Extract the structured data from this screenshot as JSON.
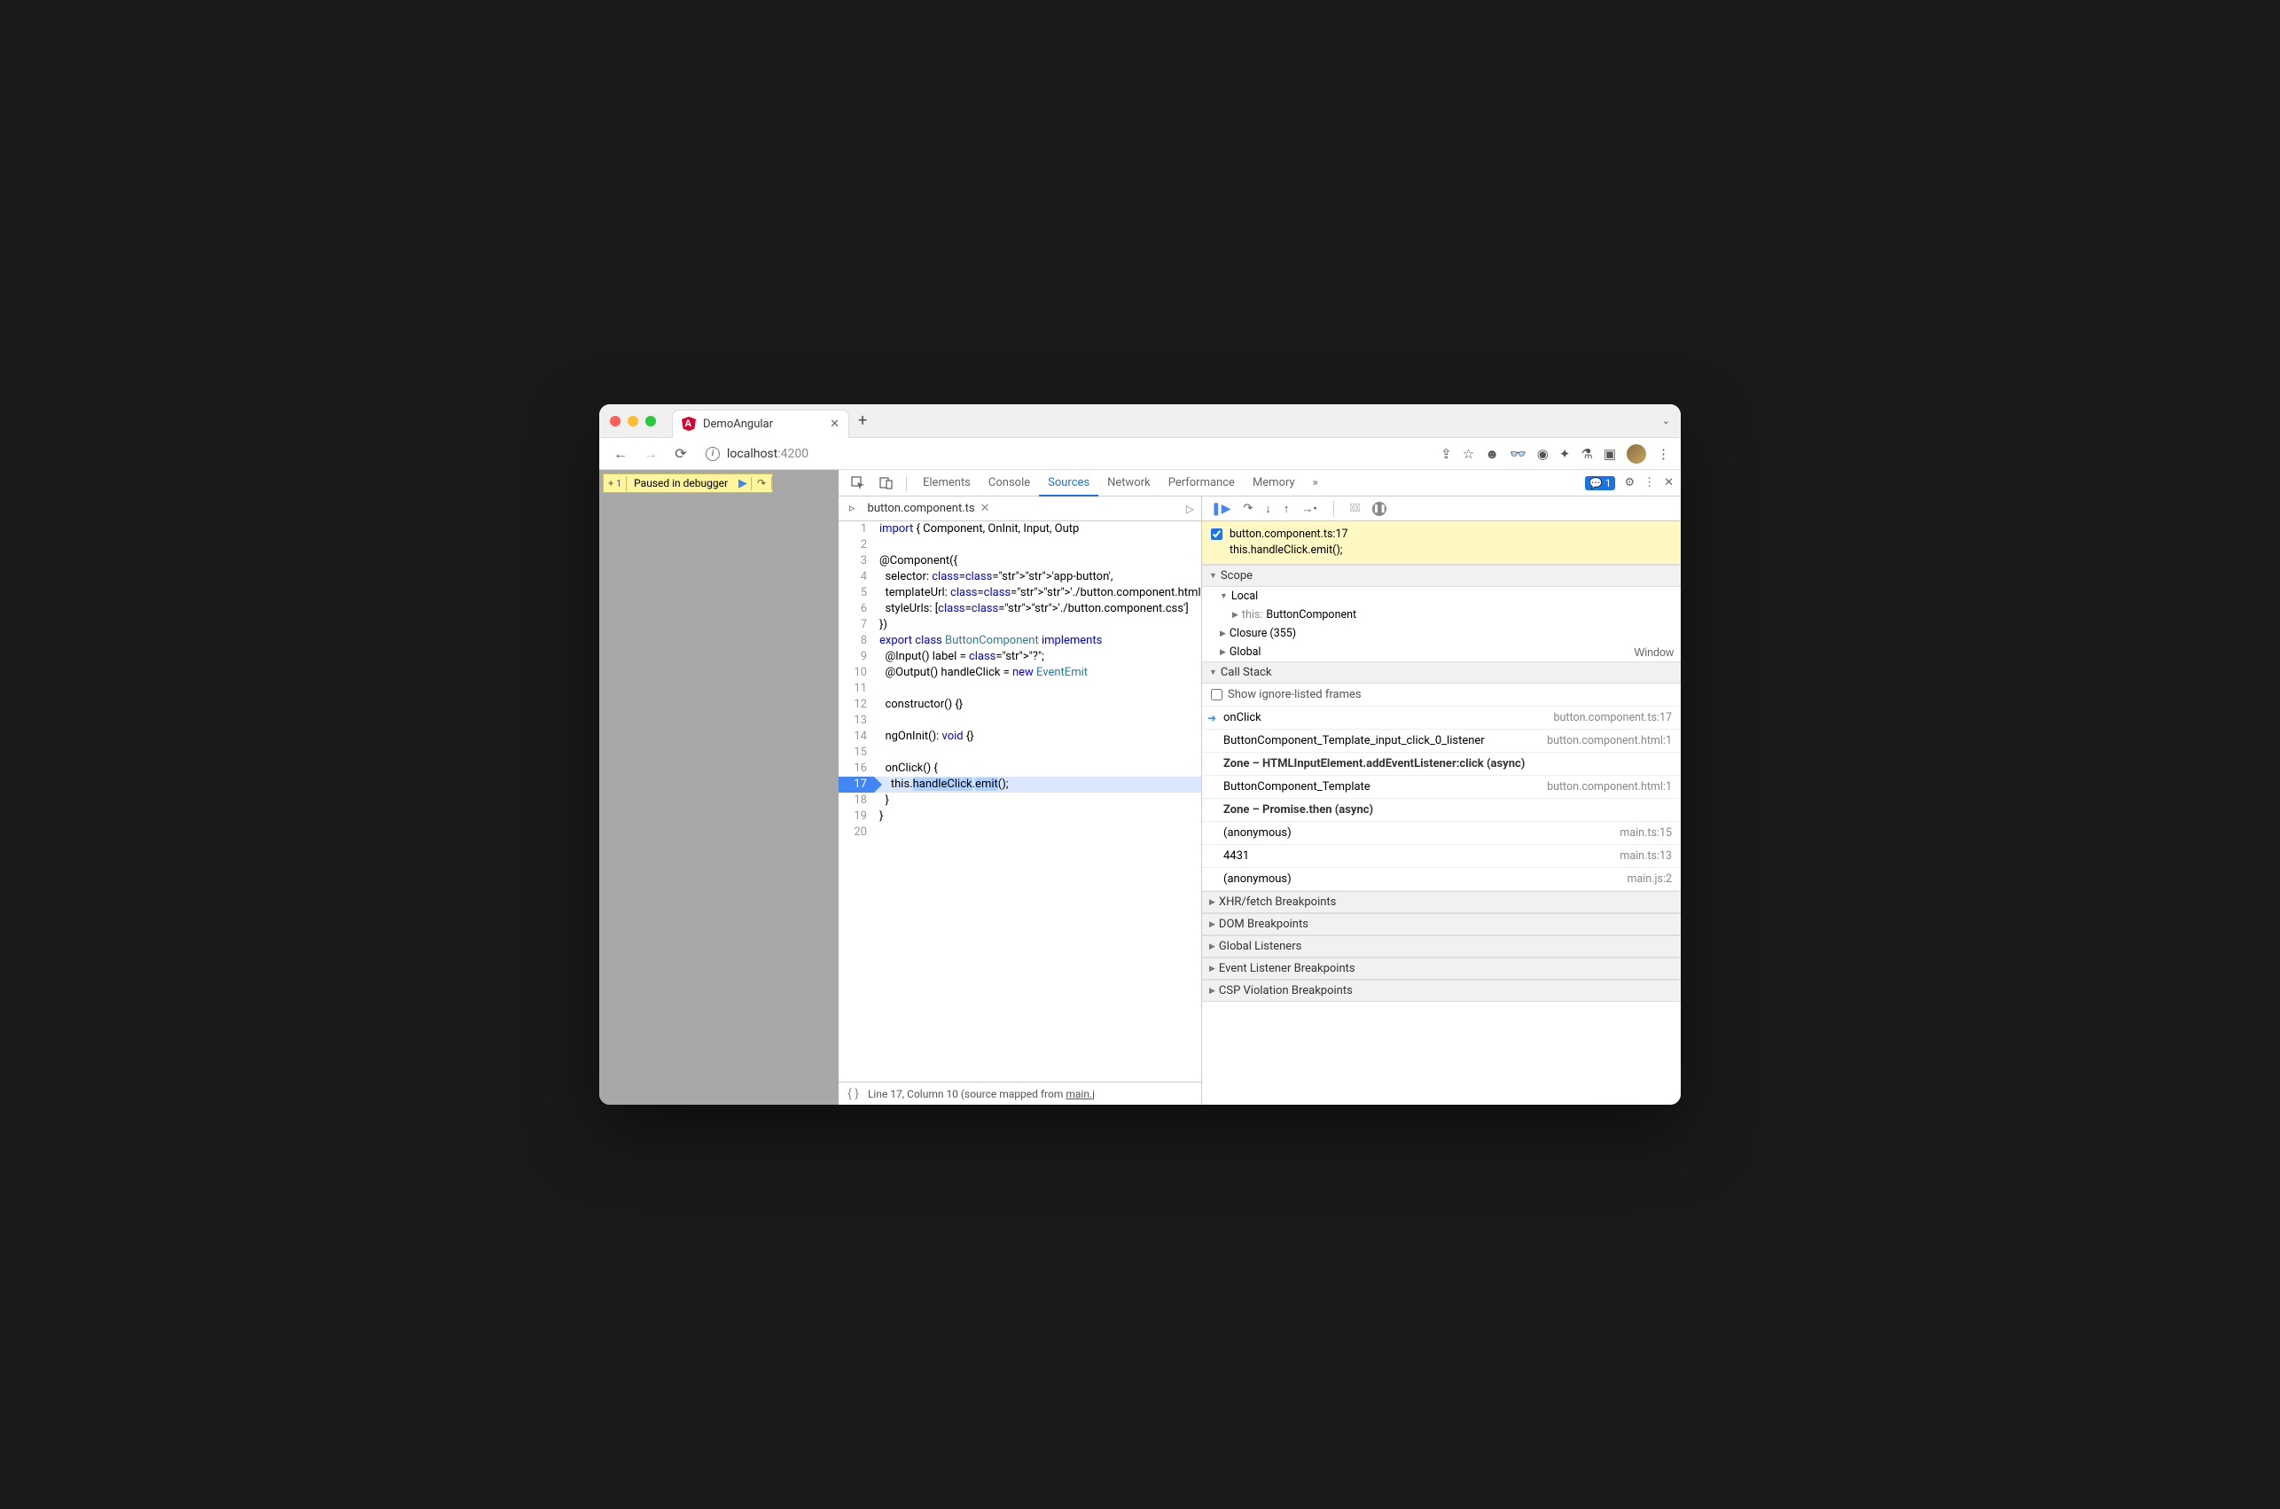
{
  "browser": {
    "tab_title": "DemoAngular",
    "url_host": "localhost",
    "url_port": ":4200"
  },
  "paused_overlay": {
    "text": "Paused in debugger"
  },
  "devtools_tabs": [
    "Elements",
    "Console",
    "Sources",
    "Network",
    "Performance",
    "Memory"
  ],
  "devtools_active_tab": "Sources",
  "issues_count": "1",
  "editor": {
    "filename": "button.component.ts",
    "status": "Line 17, Column 10  (source mapped from ",
    "status_link": "main.j"
  },
  "code": {
    "lines": [
      {
        "n": 1,
        "raw": "import { Component, OnInit, Input, Outp"
      },
      {
        "n": 2,
        "raw": ""
      },
      {
        "n": 3,
        "raw": "@Component({"
      },
      {
        "n": 4,
        "raw": "  selector: 'app-button',"
      },
      {
        "n": 5,
        "raw": "  templateUrl: './button.component.html'"
      },
      {
        "n": 6,
        "raw": "  styleUrls: ['./button.component.css']"
      },
      {
        "n": 7,
        "raw": "})"
      },
      {
        "n": 8,
        "raw": "export class ButtonComponent implements"
      },
      {
        "n": 9,
        "raw": "  @Input() label = \"?\";"
      },
      {
        "n": 10,
        "raw": "  @Output() handleClick = new EventEmit"
      },
      {
        "n": 11,
        "raw": ""
      },
      {
        "n": 12,
        "raw": "  constructor() {}"
      },
      {
        "n": 13,
        "raw": ""
      },
      {
        "n": 14,
        "raw": "  ngOnInit(): void {}"
      },
      {
        "n": 15,
        "raw": ""
      },
      {
        "n": 16,
        "raw": "  onClick() {"
      },
      {
        "n": 17,
        "raw": "    this.▶handleClick.▶emit();",
        "paused": true
      },
      {
        "n": 18,
        "raw": "  }"
      },
      {
        "n": 19,
        "raw": "}"
      },
      {
        "n": 20,
        "raw": ""
      }
    ]
  },
  "breakpoint_hit": {
    "file": "button.component.ts:17",
    "line": "this.handleClick.emit();"
  },
  "scope": {
    "header": "Scope",
    "local_label": "Local",
    "this_label": "this:",
    "this_value": "ButtonComponent",
    "closure_label": "Closure (355)",
    "global_label": "Global",
    "global_value": "Window"
  },
  "callstack": {
    "header": "Call Stack",
    "show_ignore": "Show ignore-listed frames",
    "frames": [
      {
        "name": "onClick",
        "loc": "button.component.ts:17",
        "current": true
      },
      {
        "name": "ButtonComponent_Template_input_click_0_listener",
        "loc": "button.component.html:1"
      },
      {
        "name": "Zone – HTMLInputElement.addEventListener:click (async)",
        "zone": true
      },
      {
        "name": "ButtonComponent_Template",
        "loc": "button.component.html:1"
      },
      {
        "name": "Zone – Promise.then (async)",
        "zone": true
      },
      {
        "name": "(anonymous)",
        "loc": "main.ts:15"
      },
      {
        "name": "4431",
        "loc": "main.ts:13"
      },
      {
        "name": "(anonymous)",
        "loc": "main.js:2"
      }
    ]
  },
  "sections": [
    "XHR/fetch Breakpoints",
    "DOM Breakpoints",
    "Global Listeners",
    "Event Listener Breakpoints",
    "CSP Violation Breakpoints"
  ]
}
